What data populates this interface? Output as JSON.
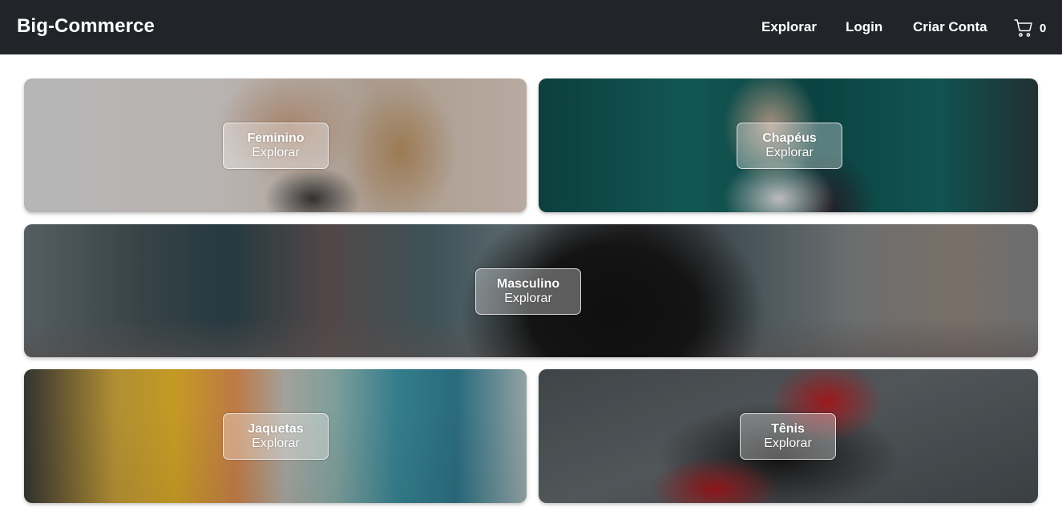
{
  "navbar": {
    "brand": "Big-Commerce",
    "links": [
      "Explorar",
      "Login",
      "Criar Conta"
    ],
    "cart_icon": "cart-icon",
    "cart_count": "0"
  },
  "categories": [
    {
      "title": "Feminino",
      "action": "Explorar"
    },
    {
      "title": "Chapéus",
      "action": "Explorar"
    },
    {
      "title": "Masculino",
      "action": "Explorar"
    },
    {
      "title": "Jaquetas",
      "action": "Explorar"
    },
    {
      "title": "Tênis",
      "action": "Explorar"
    }
  ],
  "colors": {
    "navbar_bg": "#212529",
    "text": "#ffffff"
  }
}
